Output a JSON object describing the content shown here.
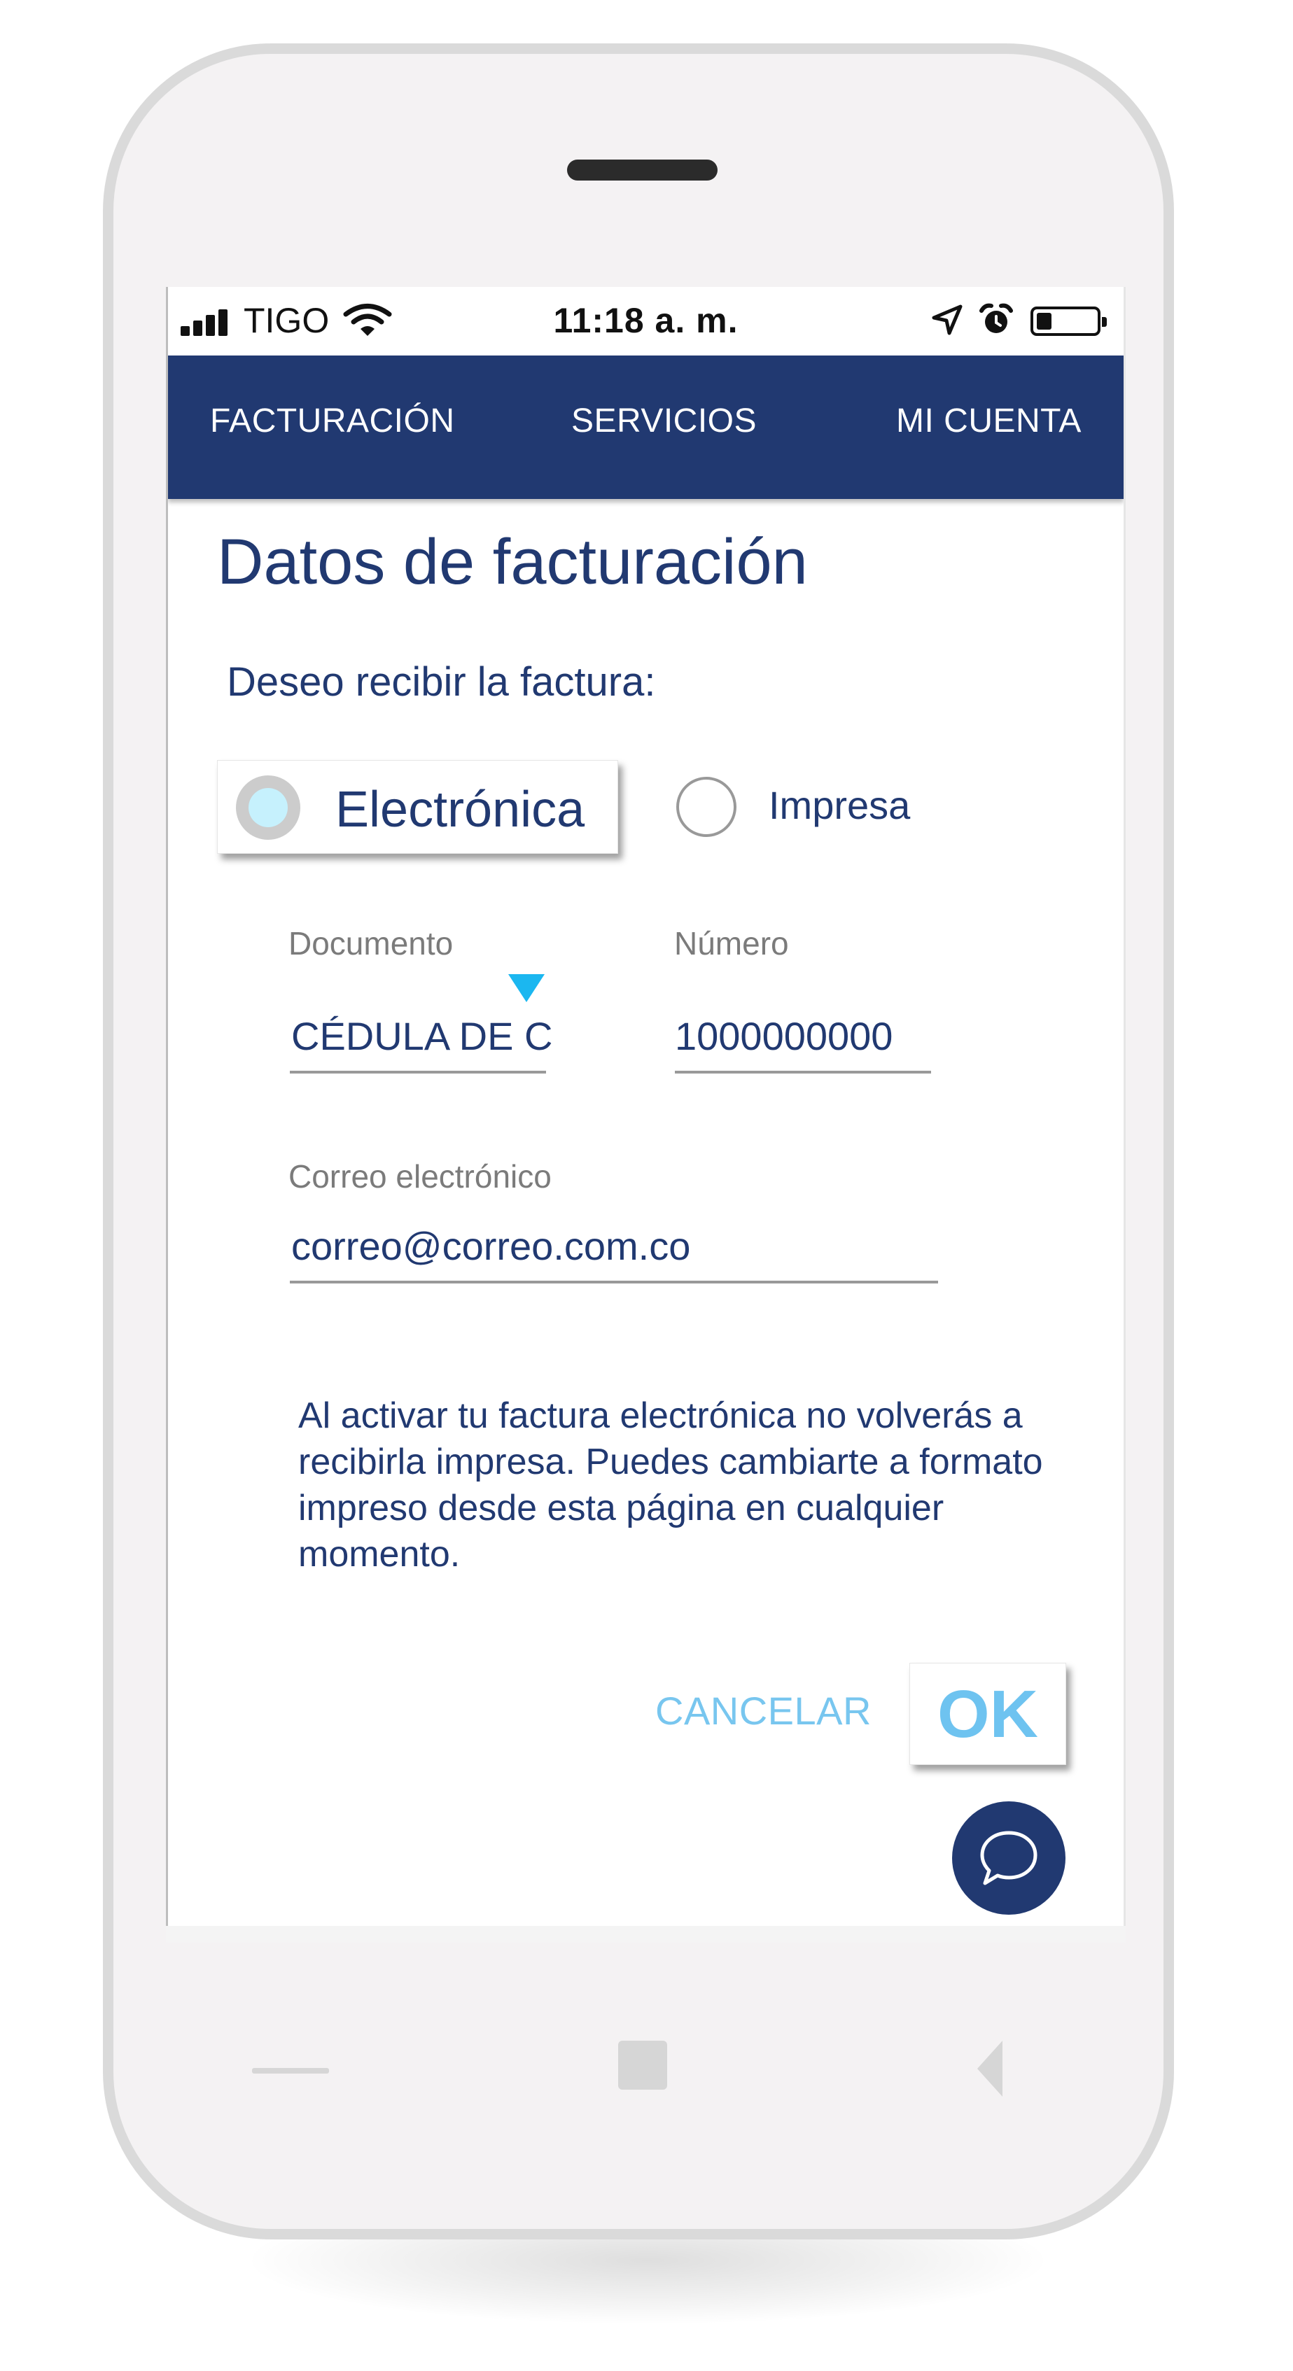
{
  "status_bar": {
    "carrier": "TIGO",
    "time": "11:18 a. m.",
    "signal_bars": 4,
    "battery_percent": 25,
    "icons": [
      "signal-icon",
      "wifi-icon",
      "location-arrow-icon",
      "alarm-icon",
      "battery-icon"
    ]
  },
  "nav": {
    "tabs": [
      {
        "label": "FACTURACIÓN"
      },
      {
        "label": "SERVICIOS"
      },
      {
        "label": "MI CUENTA"
      }
    ]
  },
  "form": {
    "title": "Datos de facturación",
    "prompt": "Deseo recibir la factura:",
    "delivery_options": [
      {
        "label": "Electrónica",
        "selected": true
      },
      {
        "label": "Impresa",
        "selected": false
      }
    ],
    "document": {
      "label": "Documento",
      "value": "CÉDULA DE C"
    },
    "number": {
      "label": "Número",
      "value": "1000000000"
    },
    "email": {
      "label": "Correo electrónico",
      "value": "correo@correo.com.co"
    },
    "info_text": "Al activar tu factura electrónica no volverás a recibirla impresa. Puedes cambiarte a formato impreso desde esta página en cualquier momento.",
    "cancel_label": "CANCELAR",
    "ok_label": "OK"
  },
  "colors": {
    "brand_navy": "#213971",
    "accent_light_blue": "#6ec3f0",
    "dropdown_arrow": "#1bb7f0",
    "radio_selected_fill": "#c6f1fd"
  }
}
